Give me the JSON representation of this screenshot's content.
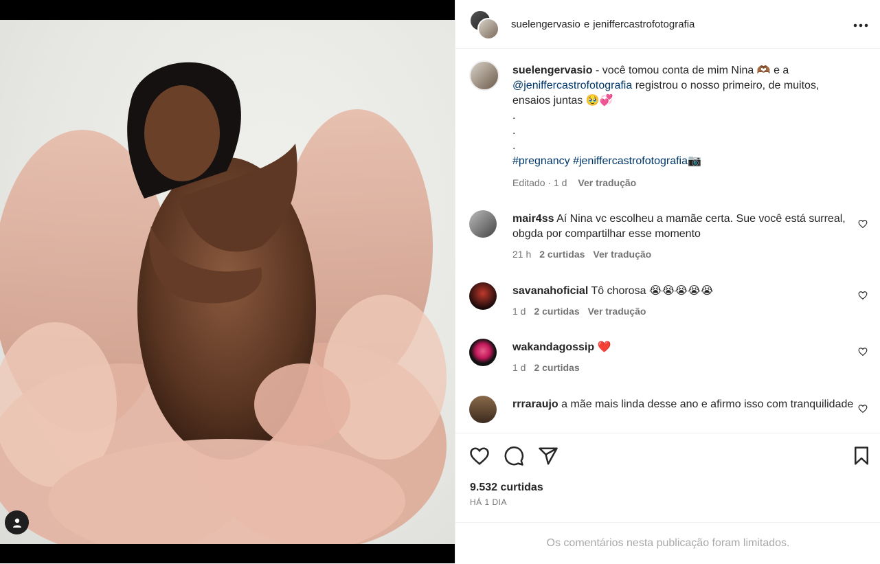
{
  "header": {
    "user1": "suelengervasio",
    "connector": "e",
    "user2": "jeniffercastrofotografia"
  },
  "caption": {
    "username": "suelengervasio",
    "text_1": " - você tomou conta de mim Nina ",
    "emoji_1": "🫶🏾",
    "text_2": " e a ",
    "mention": "@jeniffercastrofotografia",
    "text_3": " registrou o nosso primeiro, de muitos, ensaios juntas ",
    "emoji_2": "🥹💞",
    "dots": [
      ".",
      ".",
      "."
    ],
    "hashtag1": "#pregnancy",
    "hashtag2": "#jeniffercastrofotografia",
    "emoji_3": "📷",
    "edited": "Editado",
    "sep": "·",
    "time": "1 d",
    "translate": "Ver tradução"
  },
  "comments": [
    {
      "username": "mair4ss",
      "text": "Aí Nina vc escolheu a mamãe certa. Sue você está surreal, obgda por compartilhar esse momento",
      "time": "21 h",
      "likes": "2 curtidas",
      "translate": "Ver tradução"
    },
    {
      "username": "savanahoficial",
      "text": "Tô chorosa 😭😭😭😭😭",
      "time": "1 d",
      "likes": "2 curtidas",
      "translate": "Ver tradução"
    },
    {
      "username": "wakandagossip",
      "text": "❤️",
      "time": "1 d",
      "likes": "2 curtidas",
      "translate": ""
    },
    {
      "username": "rrraraujo",
      "text": "a mãe mais linda desse ano e afirmo isso com tranquilidade"
    }
  ],
  "footer": {
    "likes": "9.532 curtidas",
    "ago": "HÁ 1 DIA",
    "limited": "Os comentários nesta publicação foram limitados."
  },
  "icons": {
    "like": "heart-icon",
    "comment": "comment-icon",
    "share": "share-icon",
    "save": "bookmark-icon",
    "more": "more-options-icon",
    "tag": "user-tag-icon"
  },
  "colors": {
    "link": "#00376b",
    "muted": "#737373",
    "heart": "#ed4956"
  }
}
